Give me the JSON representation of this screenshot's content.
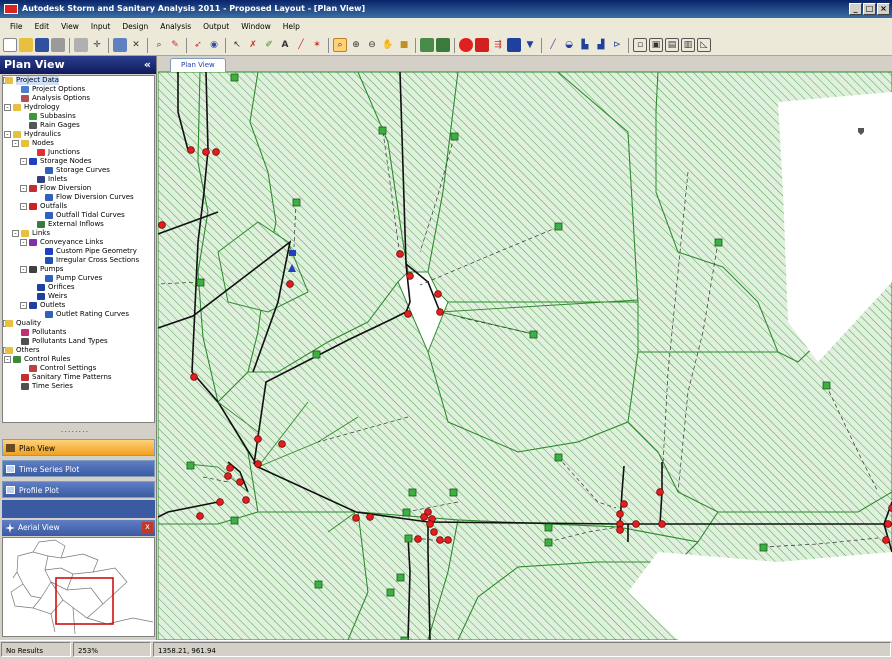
{
  "window": {
    "title": "Autodesk Storm and Sanitary Analysis 2011 - Proposed Layout - [Plan View]",
    "buttons": [
      "_",
      "□",
      "×"
    ]
  },
  "menu": [
    "File",
    "Edit",
    "View",
    "Input",
    "Design",
    "Analysis",
    "Output",
    "Window",
    "Help"
  ],
  "left_panel": {
    "title": "Plan View",
    "collapse": "«",
    "tree": [
      {
        "label": "Project Data",
        "level": 0,
        "icon": "folder-icon",
        "color": "#e8c040",
        "expander": "-"
      },
      {
        "label": "Project Options",
        "level": 2,
        "icon": "checklist-icon",
        "color": "#4a7fd0"
      },
      {
        "label": "Analysis Options",
        "level": 2,
        "icon": "tools-icon",
        "color": "#b05050"
      },
      {
        "label": "Hydrology",
        "level": 1,
        "icon": "folder-icon",
        "color": "#e8c040",
        "expander": "-"
      },
      {
        "label": "Subbasins",
        "level": 3,
        "icon": "subbasin-icon",
        "color": "#3a9a3a"
      },
      {
        "label": "Rain Gages",
        "level": 3,
        "icon": "raingage-icon",
        "color": "#555555"
      },
      {
        "label": "Hydraulics",
        "level": 1,
        "icon": "folder-icon",
        "color": "#e8c040",
        "expander": "-"
      },
      {
        "label": "Nodes",
        "level": 2,
        "icon": "folder-icon",
        "color": "#e8c040",
        "expander": "-"
      },
      {
        "label": "Junctions",
        "level": 4,
        "icon": "junction-icon",
        "color": "#e03030"
      },
      {
        "label": "Storage Nodes",
        "level": 3,
        "icon": "storage-icon",
        "color": "#2040c0",
        "expander": "-"
      },
      {
        "label": "Storage Curves",
        "level": 5,
        "icon": "curve-icon",
        "color": "#3060c0"
      },
      {
        "label": "Inlets",
        "level": 4,
        "icon": "inlet-icon",
        "color": "#304080"
      },
      {
        "label": "Flow Diversion",
        "level": 3,
        "icon": "diversion-icon",
        "color": "#c03030",
        "expander": "-"
      },
      {
        "label": "Flow Diversion Curves",
        "level": 5,
        "icon": "curve-icon",
        "color": "#3060c0"
      },
      {
        "label": "Outfalls",
        "level": 3,
        "icon": "outfall-icon",
        "color": "#d02020",
        "expander": "-"
      },
      {
        "label": "Outfall Tidal Curves",
        "level": 5,
        "icon": "curve-icon",
        "color": "#3060c0"
      },
      {
        "label": "External Inflows",
        "level": 4,
        "icon": "inflow-icon",
        "color": "#3a7a3a"
      },
      {
        "label": "Links",
        "level": 2,
        "icon": "folder-icon",
        "color": "#e8c040",
        "expander": "-"
      },
      {
        "label": "Conveyance Links",
        "level": 3,
        "icon": "link-icon",
        "color": "#8030a0",
        "expander": "-"
      },
      {
        "label": "Custom Pipe Geometry",
        "level": 5,
        "icon": "pipe-icon",
        "color": "#2040c0"
      },
      {
        "label": "Irregular Cross Sections",
        "level": 5,
        "icon": "crosssection-icon",
        "color": "#2050c0"
      },
      {
        "label": "Pumps",
        "level": 3,
        "icon": "pump-icon",
        "color": "#404040",
        "expander": "-"
      },
      {
        "label": "Pump Curves",
        "level": 5,
        "icon": "curve-icon",
        "color": "#3060c0"
      },
      {
        "label": "Orifices",
        "level": 4,
        "icon": "orifice-icon",
        "color": "#2040a0"
      },
      {
        "label": "Weirs",
        "level": 4,
        "icon": "weir-icon",
        "color": "#2040a0"
      },
      {
        "label": "Outlets",
        "level": 3,
        "icon": "outlet-icon",
        "color": "#2040a0",
        "expander": "-"
      },
      {
        "label": "Outlet Rating Curves",
        "level": 5,
        "icon": "curve-icon",
        "color": "#3060c0"
      },
      {
        "label": "Quality",
        "level": 0,
        "icon": "folder-icon",
        "color": "#e8c040",
        "expander": "-"
      },
      {
        "label": "Pollutants",
        "level": 2,
        "icon": "pollutant-icon",
        "color": "#c03070"
      },
      {
        "label": "Pollutants Land Types",
        "level": 2,
        "icon": "landtype-icon",
        "color": "#505050"
      },
      {
        "label": "Others",
        "level": 0,
        "icon": "folder-icon",
        "color": "#e8c040",
        "expander": "-"
      },
      {
        "label": "Control Rules",
        "level": 1,
        "icon": "control-icon",
        "color": "#3a8a3a",
        "expander": "-"
      },
      {
        "label": "Control Settings",
        "level": 3,
        "icon": "settings-icon",
        "color": "#c04040"
      },
      {
        "label": "Sanitary Time Patterns",
        "level": 2,
        "icon": "pattern-icon",
        "color": "#c03030"
      },
      {
        "label": "Time Series",
        "level": 2,
        "icon": "clock-icon",
        "color": "#505050"
      }
    ],
    "nav_buttons": {
      "plan_view": "Plan View",
      "time_series": "Time Series Plot",
      "profile": "Profile Plot"
    },
    "aerial_title": "Aerial View",
    "aerial_close": "x"
  },
  "tabs": {
    "plan_view": "Plan View"
  },
  "status": {
    "results": "No Results",
    "zoom": "253%",
    "coords": "1358.21, 961.94"
  },
  "colors": {
    "subbasin_line": "#2e8b2e",
    "subbasin_fill": "#2e8b2e",
    "pipe": "#111111",
    "junction": "#e02020",
    "marker_fill": "#3cb043"
  }
}
